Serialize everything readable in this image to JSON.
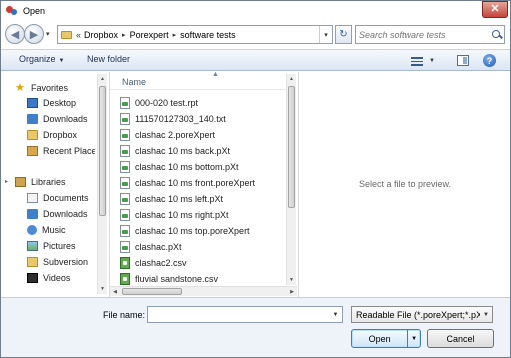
{
  "window": {
    "title": "Open",
    "close_glyph": "✕"
  },
  "address": {
    "back_glyph": "◀",
    "forward_glyph": "▶",
    "crumb_prefix": "«",
    "crumbs": [
      "Dropbox",
      "Porexpert",
      "software tests"
    ],
    "crumb_arrow": "▸",
    "refresh_glyph": "↻"
  },
  "search": {
    "placeholder": "Search software tests"
  },
  "toolbar": {
    "organize_label": "Organize",
    "new_folder_label": "New folder",
    "help_glyph": "?"
  },
  "nav": {
    "favorites_label": "Favorites",
    "favorites": [
      "Desktop",
      "Downloads",
      "Dropbox",
      "Recent Places"
    ],
    "libraries_label": "Libraries",
    "libraries": [
      "Documents",
      "Downloads",
      "Music",
      "Pictures",
      "Subversion",
      "Videos"
    ]
  },
  "filelist": {
    "column_name": "Name",
    "files": [
      "000-020 test.rpt",
      "111570127303_140.txt",
      "clashac 2.poreXpert",
      "clashac 10 ms back.pXt",
      "clashac 10 ms bottom.pXt",
      "clashac 10 ms front.poreXpert",
      "clashac 10 ms left.pXt",
      "clashac 10 ms right.pXt",
      "clashac 10 ms top.poreXpert",
      "clashac.pXt",
      "clashac2.csv",
      "fluvial sandstone.csv"
    ]
  },
  "preview": {
    "message": "Select a file to preview."
  },
  "bottom": {
    "filename_label": "File name:",
    "filename_value": "",
    "filter_value": "Readable File (*.poreXpert;*.pXt",
    "open_label": "Open",
    "cancel_label": "Cancel"
  },
  "colors": {
    "accent": "#3c7fb1",
    "toolbar_bg": "#dce6f4",
    "close_button": "#c4443a"
  }
}
